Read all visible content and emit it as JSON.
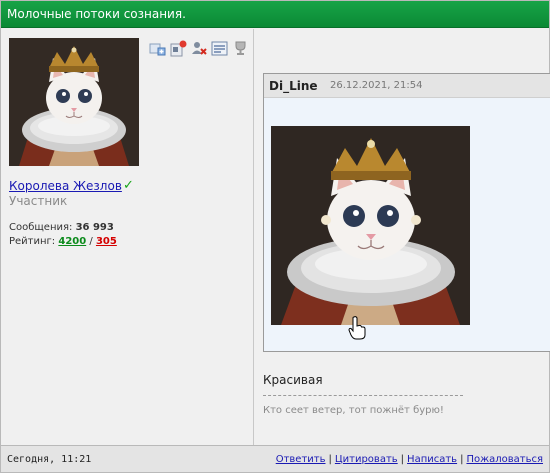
{
  "thread": {
    "title": "Молочные потоки сознания."
  },
  "author": {
    "avatar_icon": "cat-queen-avatar",
    "name": "Королева Жезлов",
    "verified_icon": "check-icon",
    "role": "Участник",
    "messages_label": "Сообщения:",
    "messages_count": "36 993",
    "rating_label": "Рейтинг:",
    "rating_positive": "4200",
    "rating_separator": "/",
    "rating_negative": "305"
  },
  "toolbar": {
    "icons": [
      "add-user-icon",
      "notification-icon",
      "block-user-icon",
      "list-icon",
      "trophy-icon"
    ]
  },
  "quote": {
    "author": "Di_Line",
    "date": "26.12.2021, 21:54",
    "image_icon": "cat-queen-image",
    "cursor_icon": "hand-cursor-icon"
  },
  "message": {
    "text": "Красивая",
    "signature": "Кто сеет ветер, тот пожнёт бурю!"
  },
  "footer": {
    "time": "Сегодня, 11:21",
    "links": {
      "reply": "Ответить",
      "quote": "Цитировать",
      "write": "Написать",
      "report": "Пожаловаться"
    },
    "separator": "|"
  },
  "colors": {
    "title_bar": "#0b8a35",
    "link": "#1a1ab3",
    "rating_positive": "#0b8a1b",
    "rating_negative": "#d40000"
  }
}
